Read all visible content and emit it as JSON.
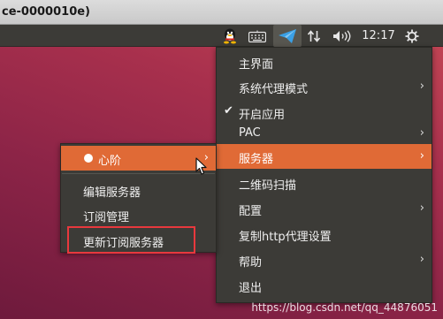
{
  "window": {
    "title": "ce-0000010e)"
  },
  "panel": {
    "clock": "12:17",
    "icons": [
      "qq-icon",
      "keyboard-icon",
      "paper-plane-icon",
      "network-arrows-icon",
      "volume-icon",
      "gear-icon"
    ]
  },
  "main_menu": {
    "items": [
      {
        "label": "主界面",
        "submenu": false
      },
      {
        "label": "系统代理模式",
        "submenu": true
      },
      {
        "label": "开启应用",
        "checked": true,
        "submenu": false
      },
      {
        "label": "PAC",
        "submenu": true
      },
      {
        "label": "服务器",
        "submenu": true,
        "highlighted": true
      },
      {
        "label": "二维码扫描",
        "submenu": false
      },
      {
        "label": "配置",
        "submenu": true
      },
      {
        "label": "复制http代理设置",
        "submenu": false
      },
      {
        "label": "帮助",
        "submenu": true
      },
      {
        "label": "退出",
        "submenu": false
      }
    ]
  },
  "server_menu": {
    "items": [
      {
        "label": "心阶",
        "selected": true,
        "submenu": true,
        "highlighted": true
      },
      {
        "label": "编辑服务器"
      },
      {
        "label": "订阅管理"
      },
      {
        "label": "更新订阅服务器",
        "annotated": true
      }
    ]
  },
  "watermark": "https://blog.csdn.net/qq_44876051",
  "colors": {
    "highlight": "#e06a36",
    "menu_bg": "#3c3b37",
    "annotation": "#e8383d"
  }
}
